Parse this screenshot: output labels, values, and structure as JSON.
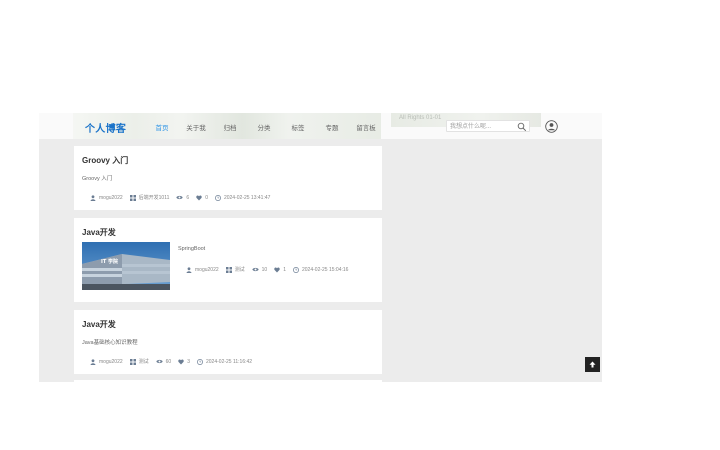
{
  "header": {
    "logo": "个人博客",
    "banner_text": "All Rights 01-01",
    "menu": [
      {
        "label": "首页",
        "active": true
      },
      {
        "label": "关于我",
        "active": false
      },
      {
        "label": "归档",
        "active": false
      },
      {
        "label": "分类",
        "active": false
      },
      {
        "label": "标签",
        "active": false
      },
      {
        "label": "专题",
        "active": false
      },
      {
        "label": "留言板",
        "active": false
      }
    ],
    "search": {
      "placeholder": "我想点什么呢..."
    }
  },
  "posts": [
    {
      "title": "Groovy 入门",
      "summary": "Groovy 入门",
      "author": "mogu2022",
      "category": "后端开发1011",
      "views": "6",
      "likes": "0",
      "date": "2024-02-25 13:41:47"
    },
    {
      "title": "Java开发",
      "summary": "SpringBoot",
      "author": "mogu2022",
      "category": "测试",
      "views": "10",
      "likes": "1",
      "date": "2024-02-25 15:04:16"
    },
    {
      "title": "Java开发",
      "summary": "Java基础核心知识教程",
      "author": "mogu2022",
      "category": "测试",
      "views": "60",
      "likes": "3",
      "date": "2024-02-25 11:16:42"
    }
  ],
  "colors": {
    "accent": "#2f95e6",
    "logo": "#1a73c9",
    "background": "#ececec"
  },
  "icons": {
    "search": "search-icon",
    "user": "user-circle-icon",
    "back_to_top": "arrow-up-icon"
  }
}
